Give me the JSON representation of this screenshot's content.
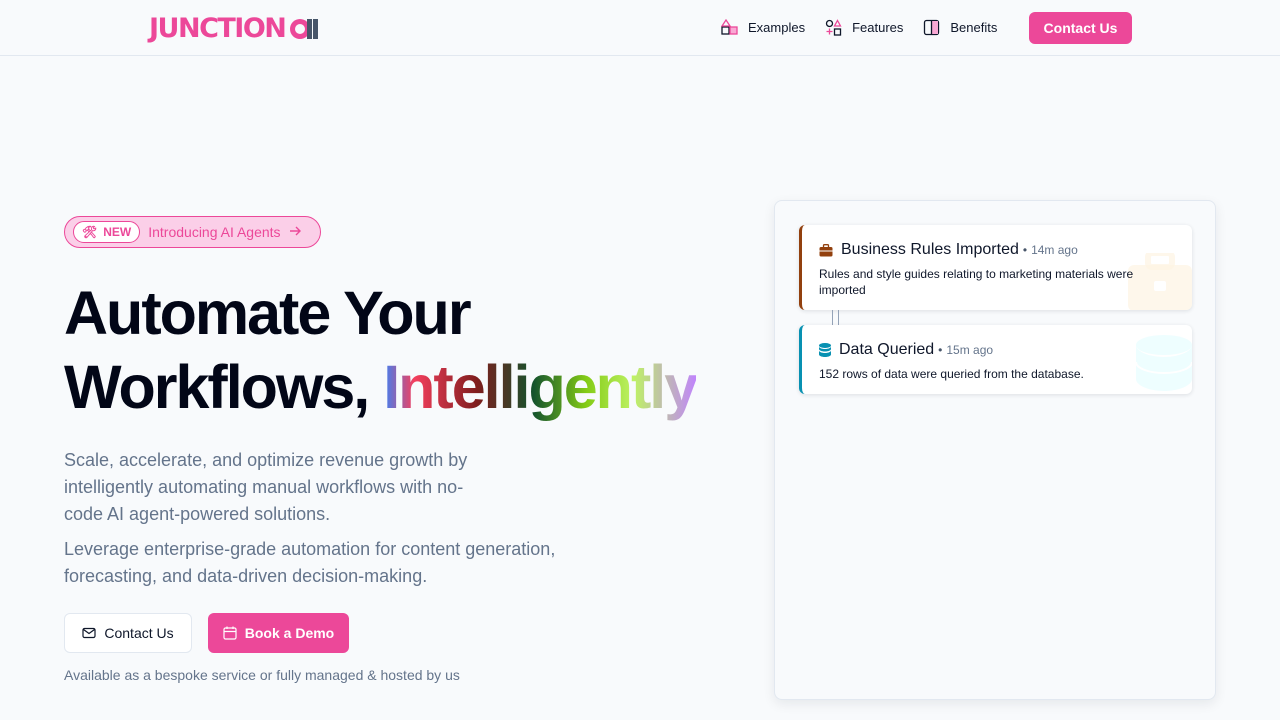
{
  "nav": {
    "logo_text": "JUNCTION",
    "logo_mark": "ai",
    "links": [
      {
        "label": "Examples",
        "icon": "shapes-icon"
      },
      {
        "label": "Features",
        "icon": "features-icon"
      },
      {
        "label": "Benefits",
        "icon": "book-icon"
      }
    ],
    "cta_label": "Contact Us"
  },
  "hero": {
    "badge_new": "NEW",
    "badge_text": "Introducing AI Agents",
    "headline_line1": "Automate Your",
    "headline_line2_prefix": "Workflows,",
    "headline_gradient_word": "Intelligently",
    "sub1": "Scale, accelerate, and optimize revenue growth by intelligently automating manual workflows with no-code AI agent-powered solutions.",
    "sub2": "Leverage enterprise-grade automation for content generation, forecasting, and data-driven decision-making.",
    "btn_contact": "Contact Us",
    "btn_demo": "Book a Demo",
    "footnote": "Available as a bespoke service or fully managed & hosted by us"
  },
  "activity": {
    "items": [
      {
        "title": "Business Rules Imported",
        "sep": "•",
        "time": "14m ago",
        "description": "Rules and style guides relating to marketing materials were imported",
        "icon": "briefcase-icon",
        "accent": "#92400e"
      },
      {
        "title": "Data Queried",
        "sep": "•",
        "time": "15m ago",
        "description": "152 rows of data were queried from the database.",
        "icon": "database-icon",
        "accent": "#0891b2"
      }
    ]
  },
  "colors": {
    "brand": "#ec4899",
    "text": "#0f172a",
    "muted": "#64748b"
  }
}
